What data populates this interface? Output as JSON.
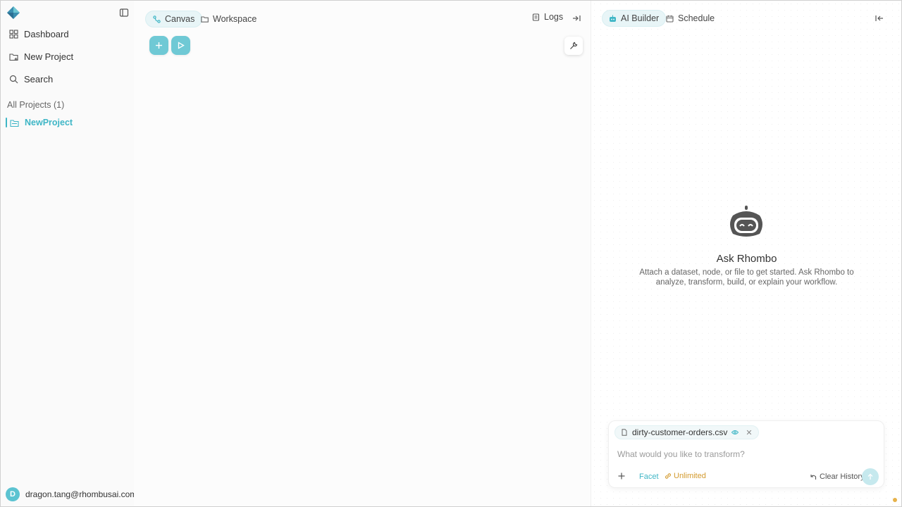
{
  "sidebar": {
    "nav": [
      {
        "label": "Dashboard",
        "icon": "grid-icon"
      },
      {
        "label": "New Project",
        "icon": "folder-plus-icon"
      },
      {
        "label": "Search",
        "icon": "search-icon"
      }
    ],
    "section_label": "All Projects (1)",
    "projects": [
      {
        "label": "NewProject",
        "icon": "folder-icon"
      }
    ],
    "user": {
      "initial": "D",
      "email": "dragon.tang@rhombusai.com"
    }
  },
  "canvas": {
    "tabs": [
      {
        "label": "Canvas",
        "icon": "node-icon",
        "active": true
      },
      {
        "label": "Workspace",
        "icon": "folder-icon",
        "active": false
      }
    ],
    "logs_label": "Logs"
  },
  "panel": {
    "tabs": [
      {
        "label": "AI Builder",
        "icon": "bot-icon",
        "active": true
      },
      {
        "label": "Schedule",
        "icon": "calendar-icon",
        "active": false
      }
    ],
    "empty_state": {
      "title": "Ask Rhombo",
      "description": "Attach a dataset, node, or file to get started. Ask Rhombo to analyze, transform, build, or explain your workflow."
    },
    "composer": {
      "attachment": "dirty-customer-orders.csv",
      "placeholder": "What would you like to transform?",
      "mode_facet": "Facet",
      "mode_unlimited": "Unlimited",
      "clear_history": "Clear History"
    }
  },
  "colors": {
    "accent": "#3fb6c6",
    "accent_soft": "#6fc9d5",
    "warning": "#d39a2e"
  }
}
